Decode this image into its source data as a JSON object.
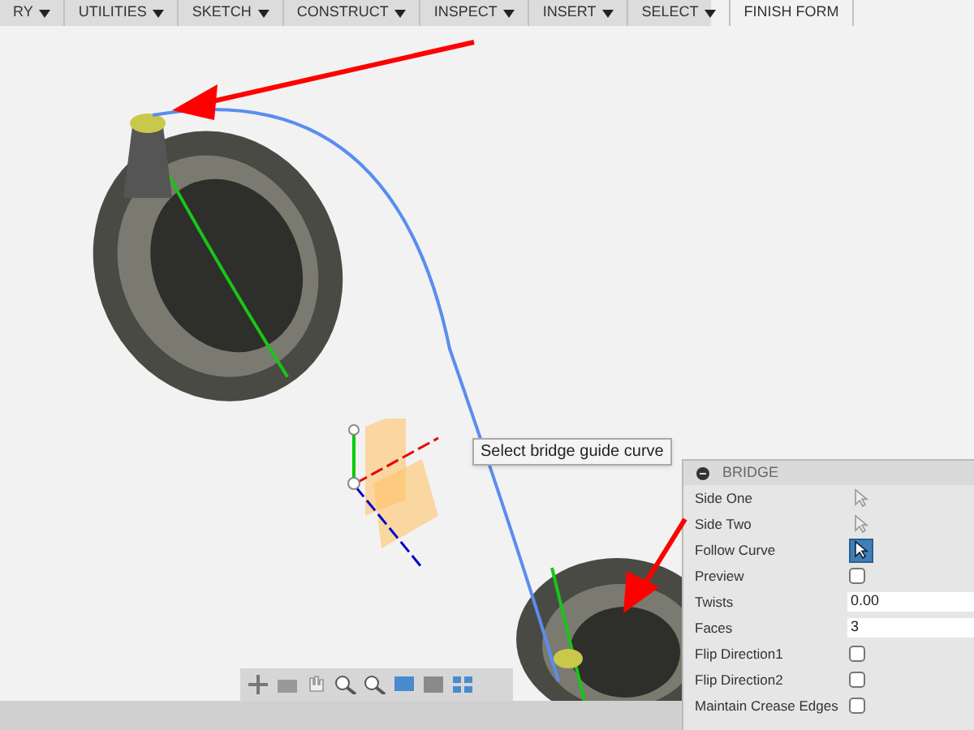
{
  "toolbar": {
    "menus": [
      {
        "label": "RY",
        "dropdown": true
      },
      {
        "label": "UTILITIES",
        "dropdown": true
      },
      {
        "label": "SKETCH",
        "dropdown": true
      },
      {
        "label": "CONSTRUCT",
        "dropdown": true
      },
      {
        "label": "INSPECT",
        "dropdown": true
      },
      {
        "label": "INSERT",
        "dropdown": true
      },
      {
        "label": "SELECT",
        "dropdown": true
      },
      {
        "label": "FINISH FORM",
        "dropdown": false
      }
    ]
  },
  "tooltip": "Select bridge guide curve",
  "panel": {
    "title": "BRIDGE",
    "rows": [
      {
        "kind": "pick",
        "label": "Side One",
        "selected": false
      },
      {
        "kind": "pick",
        "label": "Side Two",
        "selected": false
      },
      {
        "kind": "pick",
        "label": "Follow Curve",
        "selected": true
      },
      {
        "kind": "checkbox",
        "label": "Preview",
        "checked": false
      },
      {
        "kind": "input",
        "label": "Twists",
        "value": "0.00"
      },
      {
        "kind": "input",
        "label": "Faces",
        "value": "3"
      },
      {
        "kind": "checkbox",
        "label": "Flip Direction1",
        "checked": false
      },
      {
        "kind": "checkbox",
        "label": "Flip Direction2",
        "checked": false
      },
      {
        "kind": "checkbox",
        "label": "Maintain Crease Edges",
        "checked": false
      }
    ]
  }
}
